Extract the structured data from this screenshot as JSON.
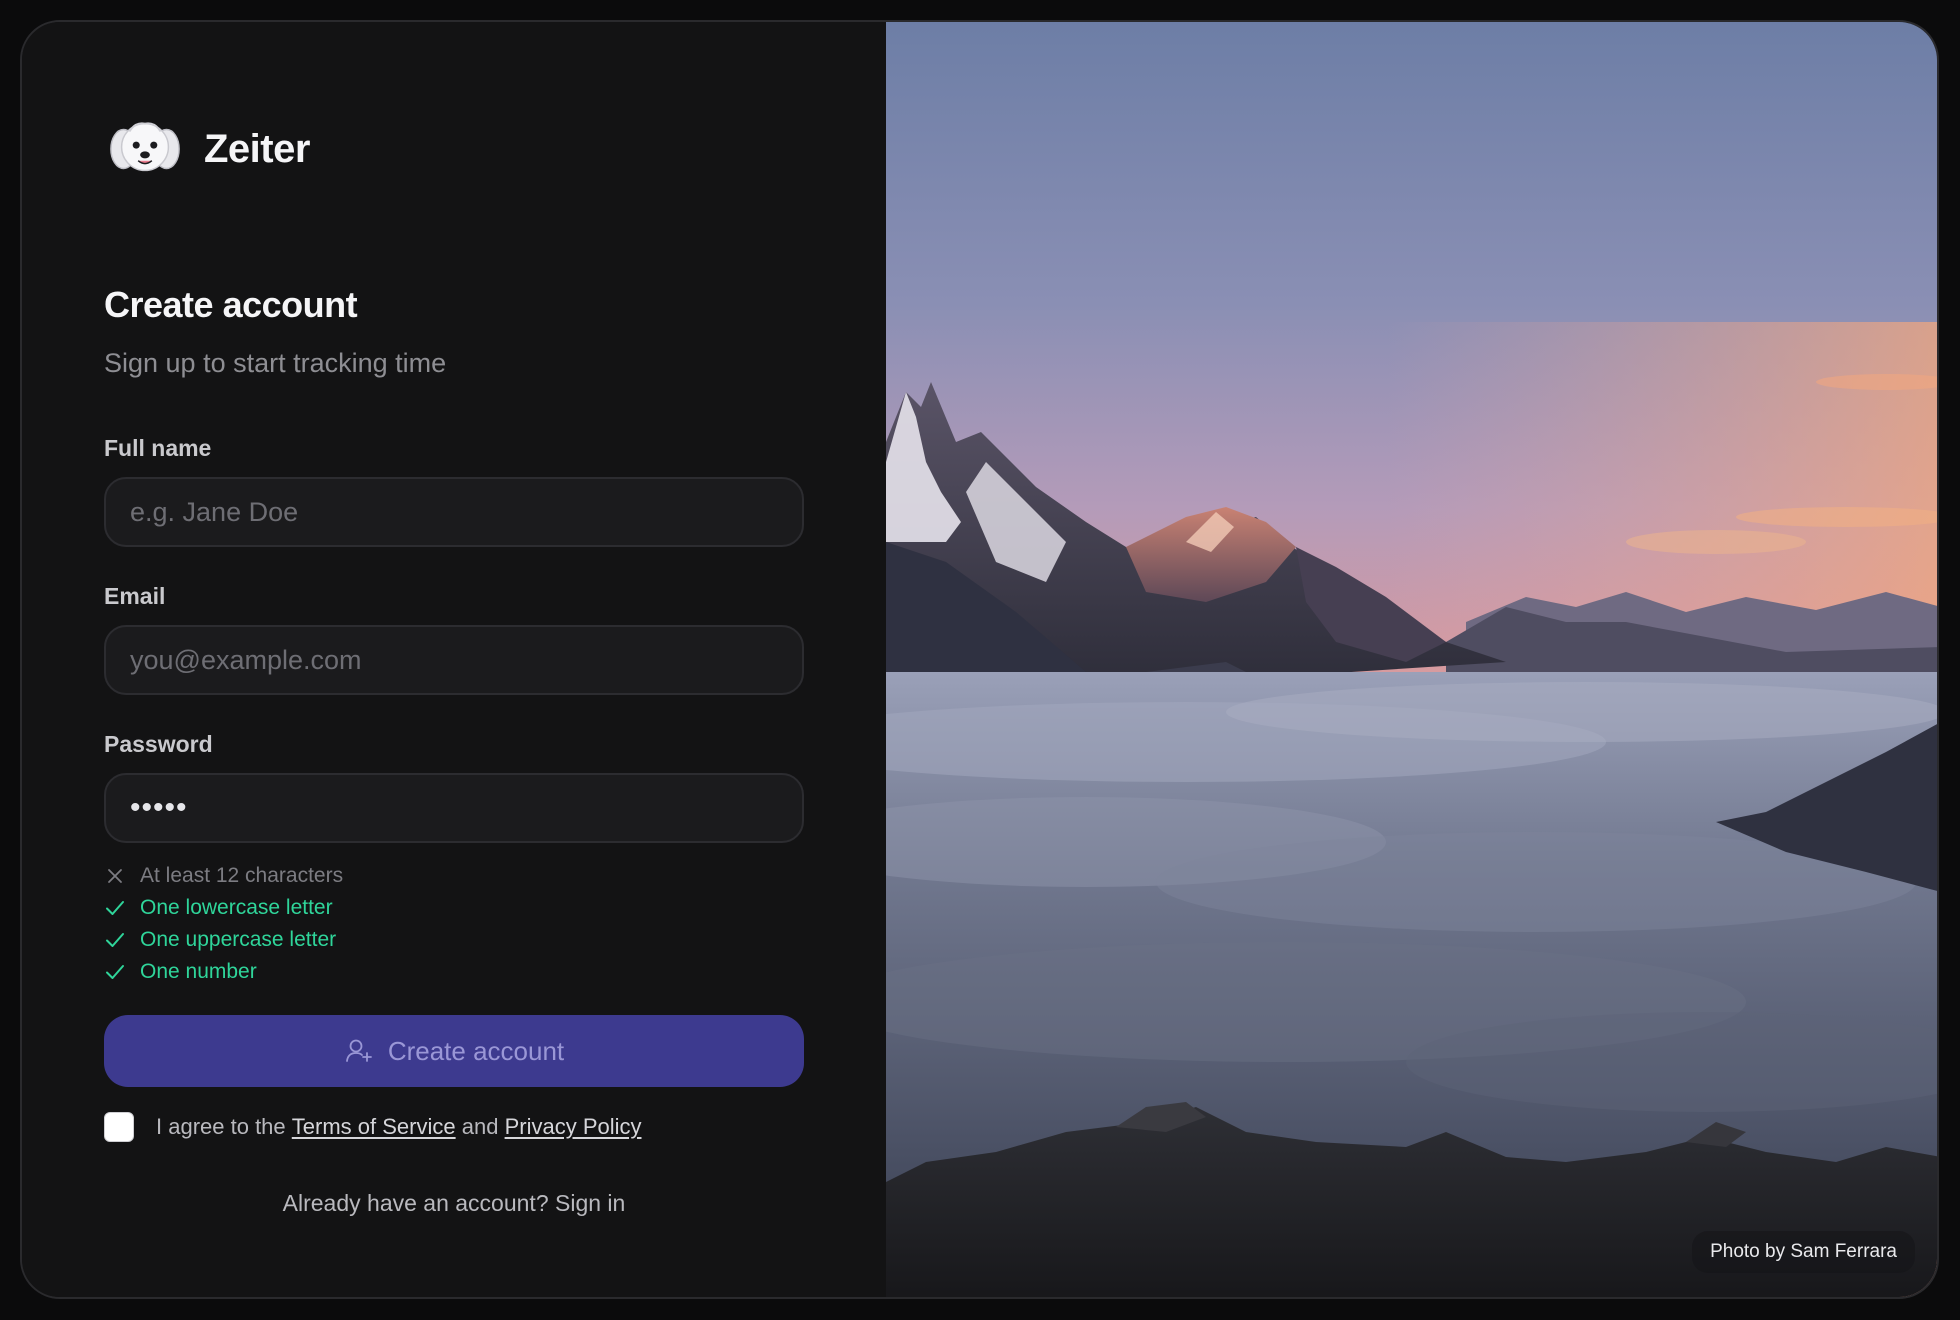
{
  "brand": {
    "name": "Zeiter",
    "logo_icon": "dog-face-icon"
  },
  "form": {
    "title": "Create account",
    "subtitle": "Sign up to start tracking time",
    "full_name": {
      "label": "Full name",
      "placeholder": "e.g. Jane Doe",
      "value": ""
    },
    "email": {
      "label": "Email",
      "placeholder": "you@example.com",
      "value": ""
    },
    "password": {
      "label": "Password",
      "value": "•••••"
    },
    "password_rules": [
      {
        "text": "At least 12 characters",
        "met": false,
        "icon": "x-icon"
      },
      {
        "text": "One lowercase letter",
        "met": true,
        "icon": "check-icon"
      },
      {
        "text": "One uppercase letter",
        "met": true,
        "icon": "check-icon"
      },
      {
        "text": "One number",
        "met": true,
        "icon": "check-icon"
      }
    ],
    "submit_label": "Create account",
    "submit_icon": "user-plus-icon",
    "agree": {
      "prefix": "I agree to the",
      "terms_link": "Terms of Service",
      "joiner": "and",
      "privacy_link": "Privacy Policy",
      "checked": false
    },
    "signin_text": "Already have an account? Sign in"
  },
  "hero": {
    "credit": "Photo by Sam Ferrara"
  },
  "colors": {
    "background": "#131314",
    "accent_button": "#3d3a8f",
    "rule_pass": "#2fd59a",
    "rule_fail": "#7c7c82"
  }
}
